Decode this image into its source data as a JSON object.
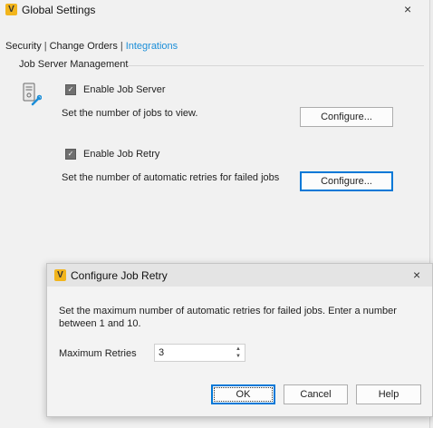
{
  "window": {
    "title": "Global Settings",
    "icon_letter": "V",
    "close_glyph": "×"
  },
  "tabs": [
    {
      "label": "Security",
      "active": false
    },
    {
      "label": "Change Orders",
      "active": false
    },
    {
      "label": "Integrations",
      "active": true
    }
  ],
  "tab_separator": "|",
  "group": {
    "label": "Job Server Management"
  },
  "job_server": {
    "checkbox_label": "Enable Job Server",
    "checked": true,
    "description": "Set the number of jobs to view.",
    "button_label": "Configure..."
  },
  "job_retry": {
    "checkbox_label": "Enable Job Retry",
    "checked": true,
    "description": "Set the number of automatic retries for failed jobs",
    "button_label": "Configure..."
  },
  "dialog": {
    "title": "Configure Job Retry",
    "icon_letter": "V",
    "close_glyph": "×",
    "message": "Set the maximum number of automatic retries for failed jobs. Enter a number between 1 and 10.",
    "field_label": "Maximum Retries",
    "field_value": "3",
    "ok_label": "OK",
    "cancel_label": "Cancel",
    "help_label": "Help"
  },
  "colors": {
    "accent": "#1b8ed8",
    "focus_border": "#0078d7",
    "app_icon": "#f2b51c"
  }
}
